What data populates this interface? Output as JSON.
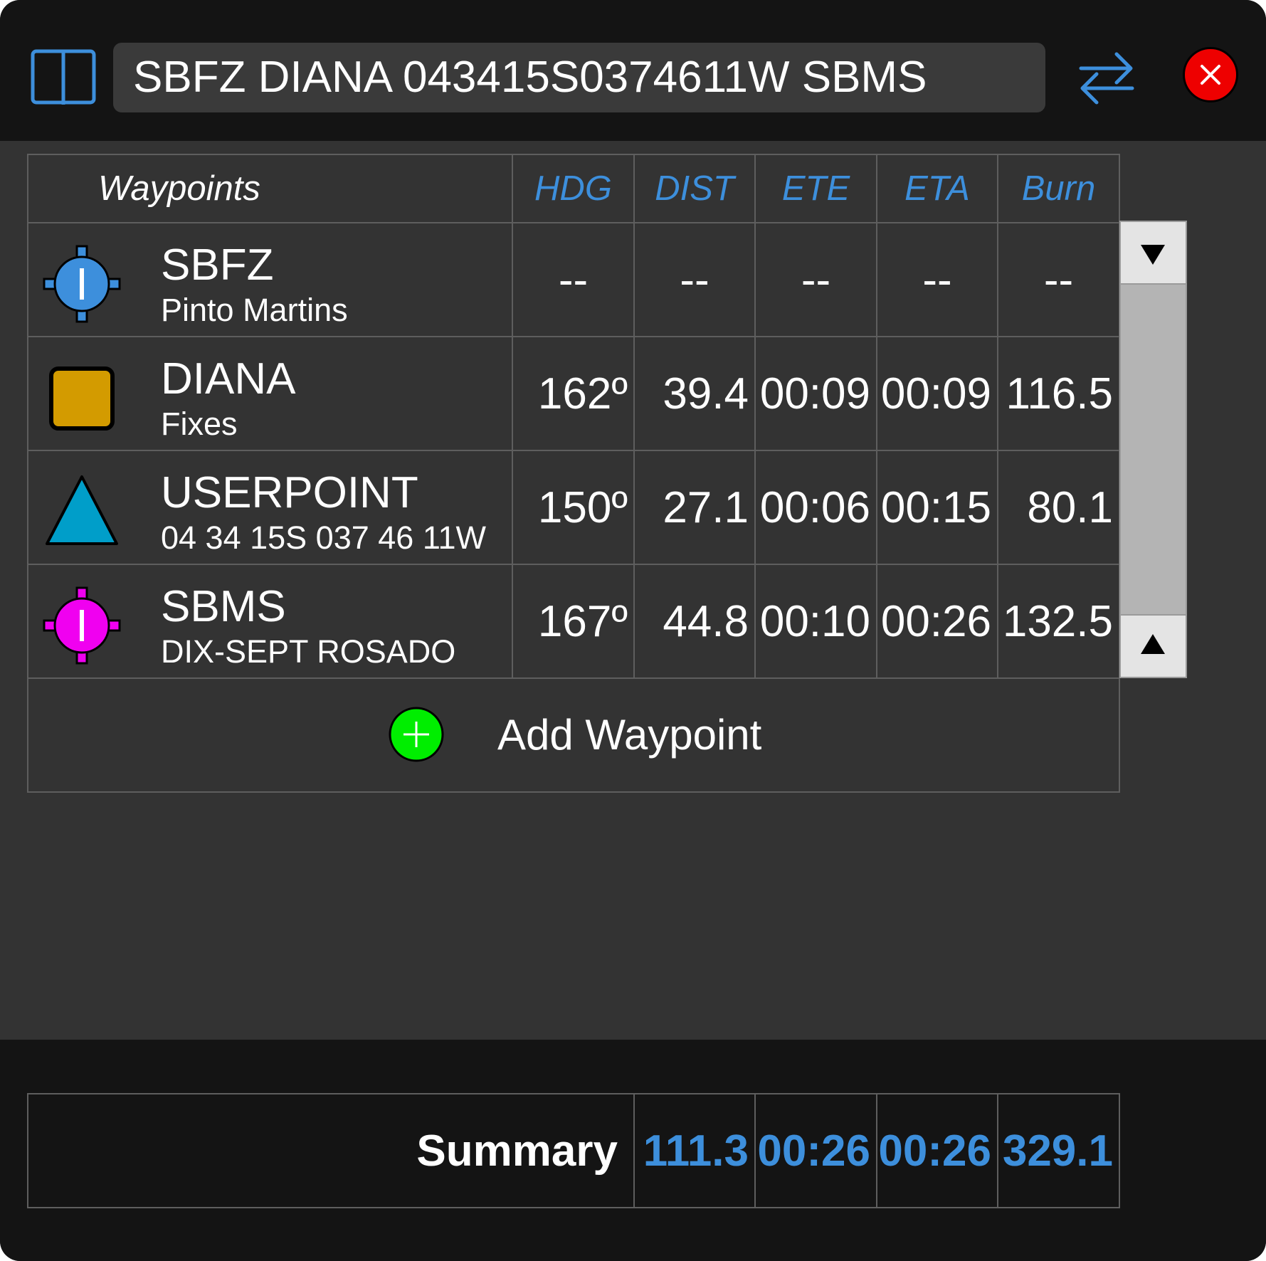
{
  "header": {
    "route": "SBFZ DIANA 043415S0374611W SBMS",
    "icons": {
      "left": "book-icon",
      "swap": "swap-arrows-icon",
      "close": "close-icon"
    },
    "accent_color": "#3d8fdc",
    "close_color": "#ee0000"
  },
  "table": {
    "columns": [
      "Waypoints",
      "HDG",
      "DIST",
      "ETE",
      "ETA",
      "Burn"
    ],
    "rows": [
      {
        "name": "SBFZ",
        "sub": "Pinto Martins",
        "icon": "airport-blue-icon",
        "hdg": "--",
        "dist": "--",
        "ete": "--",
        "eta": "--",
        "burn": "--"
      },
      {
        "name": "DIANA",
        "sub": "Fixes",
        "icon": "fix-square-icon",
        "hdg": "162º",
        "dist": "39.4",
        "ete": "00:09",
        "eta": "00:09",
        "burn": "116.5"
      },
      {
        "name": "USERPOINT",
        "sub": "04 34 15S 037 46 11W",
        "icon": "userpoint-triangle-icon",
        "hdg": "150º",
        "dist": "27.1",
        "ete": "00:06",
        "eta": "00:15",
        "burn": "80.1"
      },
      {
        "name": "SBMS",
        "sub": "DIX-SEPT ROSADO",
        "icon": "airport-magenta-icon",
        "hdg": "167º",
        "dist": "44.8",
        "ete": "00:10",
        "eta": "00:26",
        "burn": "132.5"
      }
    ],
    "add_label": "Add Waypoint"
  },
  "summary": {
    "label": "Summary",
    "dist": "111.3",
    "ete": "00:26",
    "eta": "00:26",
    "burn": "329.1"
  }
}
